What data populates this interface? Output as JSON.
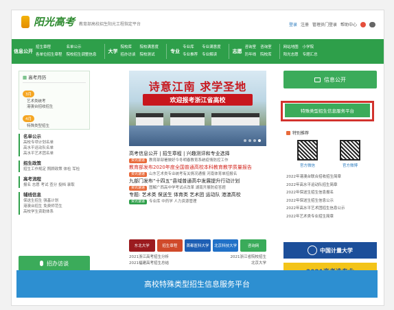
{
  "header": {
    "logo_text": "阳光高考",
    "logo_subtitle": "教育部高校招生阳光工程指定平台",
    "links": [
      "登录",
      "注册",
      "管理员门登录",
      "帮助中心"
    ]
  },
  "nav": {
    "blocks": [
      {
        "head": "信息公开",
        "cols": [
          [
            "招生章程",
            "各单位招生章程"
          ],
          [
            "名单公示",
            "院校招生调整信息"
          ]
        ]
      },
      {
        "head": "大学",
        "cols": [
          [
            "院校库",
            "招办访谈"
          ],
          [
            "院校满意度",
            "院校测试"
          ]
        ]
      },
      {
        "head": "专业",
        "cols": [
          [
            "专业库",
            "专业推荐"
          ],
          [
            "专业满意度",
            "专业解读"
          ]
        ]
      },
      {
        "head": "志愿",
        "cols": [
          [
            "咨询室",
            "历年线"
          ],
          [
            "咨询室",
            "院校库"
          ]
        ]
      },
      {
        "head": "",
        "cols": [
          [
            "网站地图",
            "阳光志愿"
          ],
          [
            "小学院",
            "专题汇总"
          ]
        ]
      }
    ]
  },
  "left": {
    "title": "高考月历",
    "months": [
      {
        "label": "3月",
        "items": [
          "艺术类统考",
          "港澳台招收招生"
        ]
      },
      {
        "label": "4月",
        "items": [
          "特殊类型招生"
        ]
      }
    ],
    "sections": [
      {
        "title": "名单公示",
        "lines": [
          "高校专项计划名单",
          "高水平运动队名单",
          "高水平艺术团名单"
        ]
      },
      {
        "title": "招生政策",
        "lines": [
          "招生工作规定  照顾政策  体检  军检"
        ]
      },
      {
        "title": "高考流程",
        "lines": [
          "报名  志愿  考试  查分  投档  录取"
        ]
      },
      {
        "title": "辅线信息",
        "lines": [
          "保送生招生  强基计划",
          "港澳台招生  免费师范生",
          "高校学生资助体系"
        ]
      }
    ],
    "consult_label": "招办访谈"
  },
  "banner": {
    "title": "诗意江南  求学圣地",
    "subtitle": "欢迎报考浙江省高校"
  },
  "news": {
    "headline_links": "高考信息公开 | 招生章程 | 兴趣测评和专业选择",
    "items": [
      {
        "tag": "资讯速递",
        "text": "教育部部署做好今冬明春教育系统疫情防控工作"
      },
      {
        "headline": "教育部发布2020年度全国普通高校本科教育教学质量报告",
        "red": true
      },
      {
        "tag": "资讯速递",
        "text": "山东艺术类专业统考有关情况通报  河南体育单招报名"
      },
      {
        "headline": "九部门发布“十四五”县域普通高中发展提升行动计划"
      },
      {
        "tag": "资讯速递",
        "text": "图解广西高中学考试点改革  湖南开展防疫答题"
      },
      {
        "headline": "专题: 艺术类 保送生 体育类 艺术团 运动队 港澳高校"
      },
      {
        "tag": "资讯速递",
        "text": "专业库  中药学  人力资源管理"
      }
    ],
    "logos": [
      {
        "label": "东北大学",
        "color": "#9b1b1f"
      },
      {
        "label": "招生章程",
        "color": "#d04a2a"
      },
      {
        "label": "首都医科大学",
        "color": "#1e5fb4"
      },
      {
        "label": "北京科技大学",
        "color": "#2171c7"
      },
      {
        "label": "咨询网",
        "color": "#3aab5a"
      }
    ],
    "link_rows": [
      [
        "2021浙江高考招生分析",
        "2021浙江省院校招生"
      ],
      [
        "2021福建高考招生总结",
        "北京大学"
      ]
    ]
  },
  "right": {
    "info_open": "信息公开",
    "special_platform": "特殊类型招生信息服务平台",
    "recommend_title": "特别推荐",
    "qr_labels": [
      "官方微信",
      "官方微博"
    ],
    "list": [
      "2022年港澳台联合招收招生简章",
      "2022年高水平运动队招生简章",
      "2022年保送生招生信息报名",
      "2022年保送生招生信息公示",
      "2022年高水平艺术团招生信息公示",
      "2022年艺术类专业招生简章"
    ],
    "university": "中国计量大学",
    "promo": "2021高考选专业"
  },
  "caption": "高校特殊类型招生信息服务平台"
}
